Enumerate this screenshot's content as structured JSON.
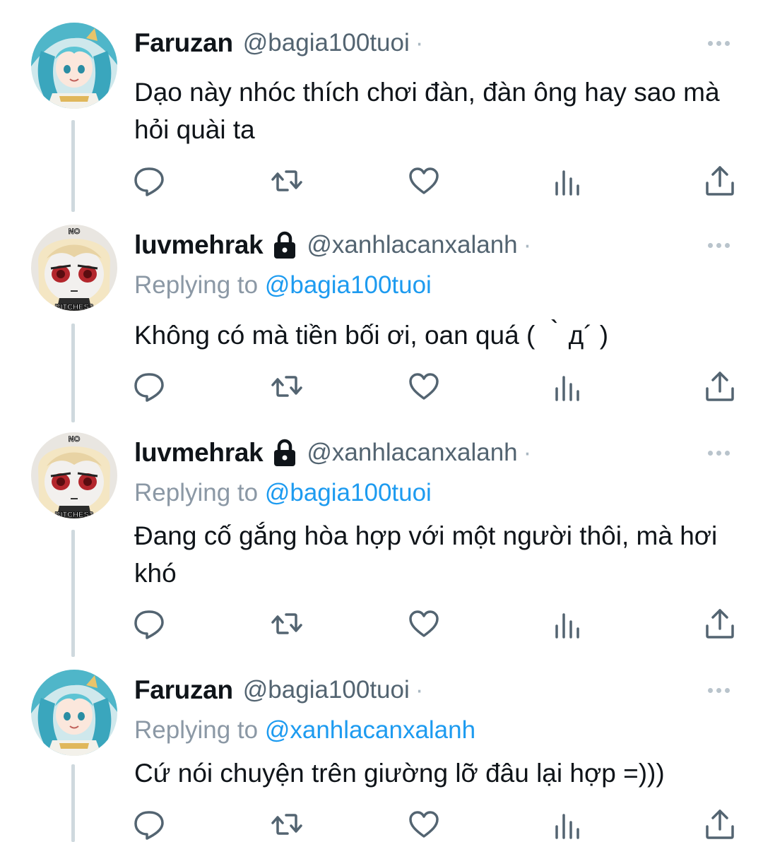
{
  "tweets": [
    {
      "display_name": "Faruzan",
      "handle": "@bagia100tuoi",
      "dot": "·",
      "protected": false,
      "replying_label": "",
      "replying_to": "",
      "text": "Dạo này nhóc thích chơi đàn, đàn ông hay sao mà hỏi quài ta",
      "avatar": "faruzan-avatar"
    },
    {
      "display_name": "luvmehrak",
      "handle": "@xanhlacanxalanh",
      "dot": "·",
      "protected": true,
      "replying_label": "Replying to",
      "replying_to": "@bagia100tuoi",
      "text": "Không có mà tiền bối ơi, oan quá ( ｀д´ )",
      "avatar": "mehrak-avatar"
    },
    {
      "display_name": "luvmehrak",
      "handle": "@xanhlacanxalanh",
      "dot": "·",
      "protected": true,
      "replying_label": "Replying to",
      "replying_to": "@bagia100tuoi",
      "text": "Đang cố gắng hòa hợp với một người thôi, mà hơi khó",
      "avatar": "mehrak-avatar"
    },
    {
      "display_name": "Faruzan",
      "handle": "@bagia100tuoi",
      "dot": "·",
      "protected": false,
      "replying_label": "Replying to",
      "replying_to": "@xanhlacanxalanh",
      "text": "Cứ nói chuyện trên giường lỡ đâu lại hợp =)))",
      "avatar": "faruzan-avatar"
    }
  ],
  "avatar_captions": {
    "top": "NO",
    "bottom": "BITCHES?"
  },
  "colors": {
    "text": "#0f1419",
    "secondary": "#536471",
    "accent": "#1d9bf0",
    "thread_line": "#cfd9de",
    "icon": "#536471"
  },
  "action_icons": [
    "reply-icon",
    "retweet-icon",
    "like-icon",
    "views-icon",
    "share-icon"
  ]
}
